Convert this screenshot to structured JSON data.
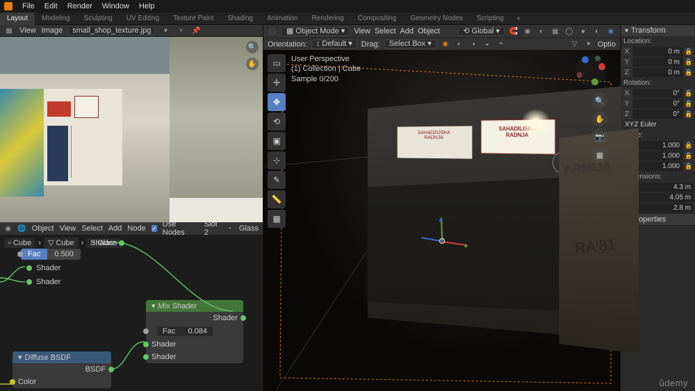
{
  "menu": {
    "items": [
      "File",
      "Edit",
      "Render",
      "Window",
      "Help"
    ]
  },
  "workspace": {
    "tabs": [
      "Layout",
      "Modeling",
      "Sculpting",
      "UV Editing",
      "Texture Paint",
      "Shading",
      "Animation",
      "Rendering",
      "Compositing",
      "Geometry Nodes",
      "Scripting"
    ],
    "active": "Layout"
  },
  "image_editor": {
    "menus": [
      "View",
      "Image"
    ],
    "image_name": "small_shop_texture.jpg"
  },
  "shader_editor": {
    "menus": [
      "View",
      "Select",
      "Add",
      "Node"
    ],
    "mode": "Object",
    "use_nodes": true,
    "use_nodes_label": "Use Nodes",
    "slot": "Slot 2",
    "material": "Glass",
    "breadcrumb": [
      "Cube",
      "Cube",
      "Glass"
    ],
    "loose": {
      "shader_out": "Shader",
      "fac_label": "Fac",
      "fac_value": "0.500",
      "shader_in1": "Shader",
      "shader_in2": "Shader"
    },
    "mix": {
      "title": "Mix Shader",
      "out": "Shader",
      "fac_label": "Fac",
      "fac_value": "0.084",
      "in1": "Shader",
      "in2": "Shader"
    },
    "diffuse": {
      "title": "Diffuse BSDF",
      "out": "BSDF",
      "color": "Color"
    }
  },
  "viewport": {
    "header": {
      "menus": [
        "View",
        "Select",
        "Add",
        "Object"
      ],
      "mode": "Object Mode",
      "global": "Global"
    },
    "header2": {
      "orientation_label": "Orientation:",
      "orientation": "Default",
      "drag_label": "Drag:",
      "drag": "Select Box",
      "options": "Optio"
    },
    "overlay": {
      "l1": "User Perspective",
      "l2": "(1) Collection | Cube",
      "l3": "Sample 0/200"
    }
  },
  "props": {
    "transform": "Transform",
    "location": {
      "label": "Location:",
      "x": "0 m",
      "y": "0 m",
      "z": "0 m"
    },
    "rotation": {
      "label": "Rotation:",
      "x": "0°",
      "y": "0°",
      "z": "0°",
      "mode": "XYZ Euler"
    },
    "scale": {
      "label": "Scale:",
      "x": "1.000",
      "y": "1.000",
      "z": "1.000"
    },
    "dimensions": {
      "label": "Dimensions:",
      "x": "4.3 m",
      "y": "4.05 m",
      "z": "2.8 m"
    },
    "properties": "Properties",
    "axes": {
      "x": "X",
      "y": "Y",
      "z": "Z"
    }
  },
  "brand": "ûdemy"
}
